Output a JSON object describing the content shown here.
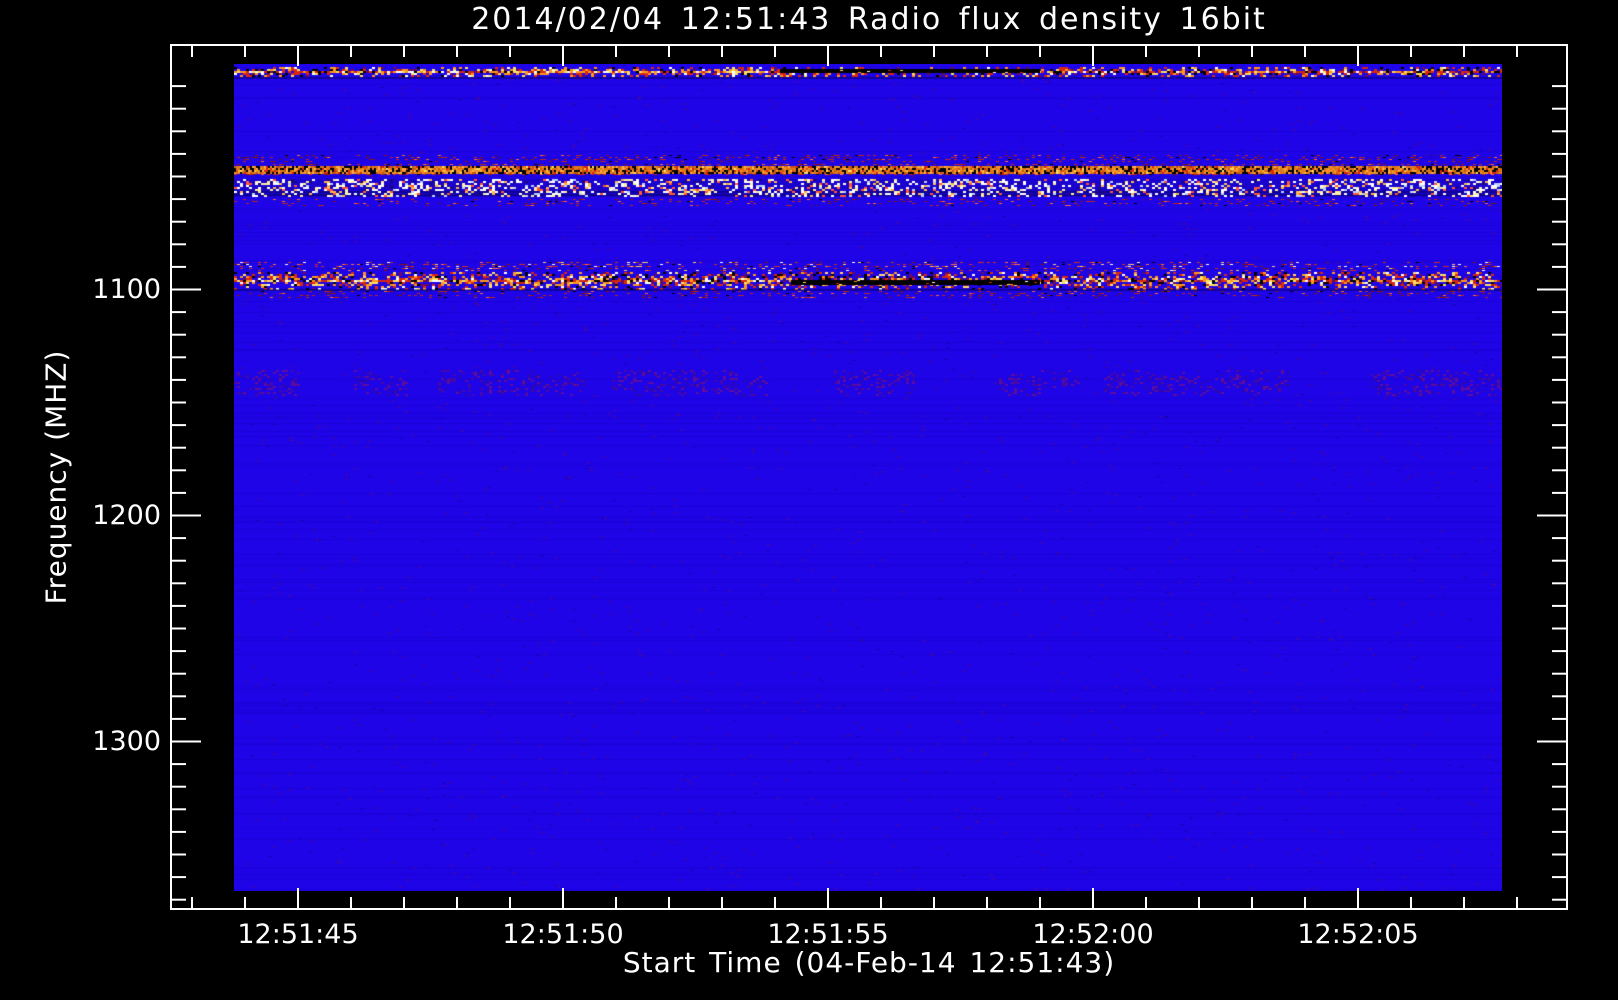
{
  "chart_data": {
    "type": "heatmap",
    "title": "2014/02/04 12:51:43 Radio flux density 16bit",
    "xlabel": "Start Time (04-Feb-14 12:51:43)",
    "ylabel": "Frequency (MHZ)",
    "x_start_time": "12:51:43",
    "x_ticks_major": [
      {
        "label": "12:51:45",
        "t": 2
      },
      {
        "label": "12:51:50",
        "t": 7
      },
      {
        "label": "12:51:55",
        "t": 12
      },
      {
        "label": "12:52:00",
        "t": 17
      },
      {
        "label": "12:52:05",
        "t": 22
      }
    ],
    "x_minor_tick_every_s": 1,
    "x_axis_range_s": [
      0,
      25
    ],
    "y_ticks_major": [
      {
        "label": "1100",
        "f": 1100
      },
      {
        "label": "1200",
        "f": 1200
      },
      {
        "label": "1300",
        "f": 1300
      }
    ],
    "y_minor_tick_every_mhz": 10,
    "y_minor_tick_range_mhz": [
      1010,
      1370
    ],
    "y_axis_range_mhz": [
      992,
      1374
    ],
    "image_freq_range_mhz": [
      1000,
      1366
    ],
    "image_time_range_s": [
      0.8,
      24.7
    ],
    "colors": {
      "page_bg": "#000000",
      "background": "#1e04e6",
      "frame": "#ffffff",
      "text": "#ffffff"
    },
    "rfi_bands": [
      {
        "name": "rfi-1003",
        "f0": 1001.4,
        "f1": 1006.0,
        "style": "strong",
        "density": 0.55
      },
      {
        "name": "rfi-1042",
        "f0": 1040.5,
        "f1": 1044.0,
        "style": "faint_red",
        "density": 0.3
      },
      {
        "name": "rfi-1047",
        "f0": 1044.5,
        "f1": 1049.8,
        "style": "orange_line",
        "density": 1.0
      },
      {
        "name": "rfi-1055",
        "f0": 1051.1,
        "f1": 1059.1,
        "style": "white_speckle",
        "density": 0.4
      },
      {
        "name": "rfi-1062",
        "f0": 1060.0,
        "f1": 1063.5,
        "style": "faint_red",
        "density": 0.22
      },
      {
        "name": "rfi-1090",
        "f0": 1087.8,
        "f1": 1091.8,
        "style": "medium_red",
        "density": 0.3
      },
      {
        "name": "rfi-1096",
        "f0": 1092.3,
        "f1": 1099.8,
        "style": "strong",
        "density": 0.6
      },
      {
        "name": "rfi-1102",
        "f0": 1100.7,
        "f1": 1103.8,
        "style": "faint_red",
        "density": 0.26
      },
      {
        "name": "rfi-1141",
        "f0": 1135.6,
        "f1": 1147.1,
        "style": "ultra_faint",
        "density": 0.5
      }
    ],
    "dark_streaks": [
      {
        "f0": 1002.6,
        "f1": 1004.4,
        "t0": 11.1,
        "t1": 16.0
      },
      {
        "f0": 1096.0,
        "f1": 1097.8,
        "t0": 11.3,
        "t1": 16.0
      }
    ],
    "band_palettes": {
      "strong": [
        [
          "#ffffff",
          10
        ],
        [
          "#ffe066",
          16
        ],
        [
          "#ff9820",
          22
        ],
        [
          "#d82810",
          28
        ],
        [
          "#000000",
          14
        ],
        [
          "#6a0c5a",
          10
        ]
      ],
      "orange_core": [
        [
          "#e07818",
          26
        ],
        [
          "#f09428",
          18
        ],
        [
          "#ffb040",
          10
        ],
        [
          "#c85a10",
          12
        ],
        [
          "#000000",
          28
        ],
        [
          "#d82810",
          8
        ],
        [
          "#ffe066",
          3
        ]
      ],
      "faint_red": [
        [
          "#c02818",
          45
        ],
        [
          "#8a1408",
          25
        ],
        [
          "#ff6a3a",
          12
        ],
        [
          "#441060",
          10
        ],
        [
          "#000000",
          8
        ]
      ],
      "medium_red": [
        [
          "#d03018",
          38
        ],
        [
          "#ff7040",
          15
        ],
        [
          "#ffffff",
          12
        ],
        [
          "#ffd060",
          12
        ],
        [
          "#8a1408",
          15
        ],
        [
          "#000000",
          8
        ]
      ],
      "white_speckle": [
        [
          "#ffffff",
          40
        ],
        [
          "#ffefa0",
          18
        ],
        [
          "#ff5838",
          14
        ],
        [
          "#ffb848",
          10
        ],
        [
          "#bcd0ff",
          9
        ],
        [
          "#1a0880",
          9
        ]
      ],
      "ultra_faint": [
        [
          "#b0184a",
          40
        ],
        [
          "#7a1060",
          30
        ],
        [
          "#3c1078",
          30
        ]
      ],
      "streak_speckle": [
        [
          "#d82810",
          40
        ],
        [
          "#ff9820",
          25
        ],
        [
          "#ffe066",
          20
        ],
        [
          "#ffffff",
          15
        ]
      ]
    }
  }
}
